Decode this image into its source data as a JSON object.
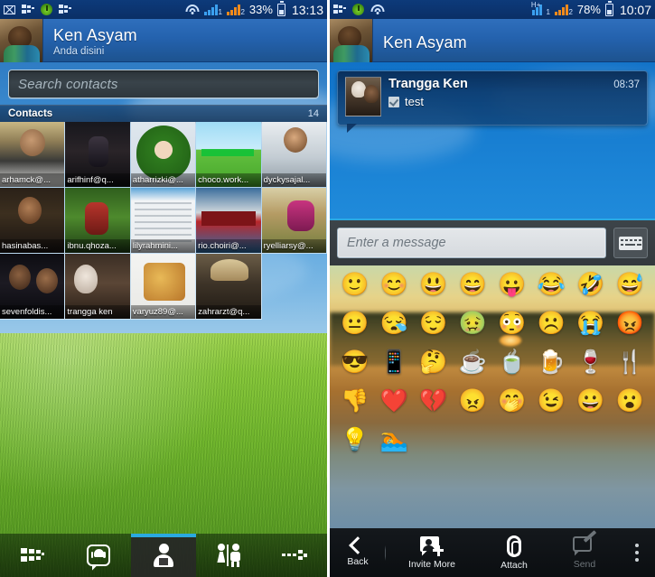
{
  "left": {
    "statusbar": {
      "icons": [
        "mail-icon",
        "bbm-icon",
        "power-icon",
        "bbm-icon-2"
      ],
      "wifi_icon": "wifi-icon",
      "signal1_label": "1",
      "signal2_label": "2",
      "battery_percent": "33%",
      "battery_icon": "battery-icon",
      "time": "13:13"
    },
    "header": {
      "name": "Ken Asyam",
      "subtitle": "Anda disini",
      "avatar": "user-avatar"
    },
    "search": {
      "placeholder": "Search contacts",
      "value": ""
    },
    "section": {
      "title": "Contacts",
      "count": "14"
    },
    "contacts": [
      {
        "name": "arhamck@...",
        "photo": "p1"
      },
      {
        "name": "arifhinf@q...",
        "photo": "p2"
      },
      {
        "name": "atharrizki@...",
        "photo": "p3"
      },
      {
        "name": "choco.work...",
        "photo": "p4"
      },
      {
        "name": "dyckysajal...",
        "photo": "p5"
      },
      {
        "name": "hasinabas...",
        "photo": "p6"
      },
      {
        "name": "ibnu.qhoza...",
        "photo": "p7"
      },
      {
        "name": "lilyrahmini...",
        "photo": "p8"
      },
      {
        "name": "rio.choiri@...",
        "photo": "p9"
      },
      {
        "name": "ryelliarsy@...",
        "photo": "p10"
      },
      {
        "name": "sevenfoldis...",
        "photo": "p11"
      },
      {
        "name": "trangga ken",
        "photo": "p12"
      },
      {
        "name": "varyuz89@...",
        "photo": "p13"
      },
      {
        "name": "zahrarzt@q...",
        "photo": "p14"
      }
    ],
    "nav": [
      {
        "name": "updates",
        "icon": "bbm-list-icon",
        "active": false
      },
      {
        "name": "chats",
        "icon": "chat-bubble-icon",
        "active": false
      },
      {
        "name": "contacts",
        "icon": "person-icon",
        "active": true
      },
      {
        "name": "groups",
        "icon": "groups-icon",
        "active": false
      },
      {
        "name": "more",
        "icon": "bbm-arrow-icon",
        "active": false
      }
    ]
  },
  "right": {
    "statusbar": {
      "icons": [
        "bbm-icon",
        "power-icon",
        "wifi-icon"
      ],
      "network_type": "H+",
      "signal1_label": "1",
      "signal2_label": "2",
      "battery_percent": "78%",
      "battery_icon": "battery-icon",
      "time": "10:07"
    },
    "header": {
      "name": "Ken Asyam",
      "avatar": "user-avatar"
    },
    "message": {
      "sender": "Trangga Ken",
      "time": "08:37",
      "text": "test",
      "status_icon": "read-check-icon",
      "avatar": "sender-avatar"
    },
    "input": {
      "placeholder": "Enter a message",
      "value": "",
      "keyboard_icon": "keyboard-icon"
    },
    "emoji_pager": {
      "page_indicator": "page-dot"
    },
    "emoji_rows": [
      [
        {
          "name": "smile",
          "glyph": "🙂"
        },
        {
          "name": "happy",
          "glyph": "😊"
        },
        {
          "name": "big-grin",
          "glyph": "😃"
        },
        {
          "name": "laugh",
          "glyph": "😄"
        },
        {
          "name": "tongue-out",
          "glyph": "😛"
        },
        {
          "name": "laughing-tears",
          "glyph": "😂"
        },
        {
          "name": "rofl",
          "glyph": "🤣"
        },
        {
          "name": "grin-sweat",
          "glyph": "😅"
        }
      ],
      [
        {
          "name": "neutral",
          "glyph": "😐"
        },
        {
          "name": "sleepy",
          "glyph": "😪"
        },
        {
          "name": "shy-smile",
          "glyph": "😌"
        },
        {
          "name": "sick-green",
          "glyph": "🤢"
        },
        {
          "name": "blushing",
          "glyph": "😳"
        },
        {
          "name": "sad-frown",
          "glyph": "☹️"
        },
        {
          "name": "crying",
          "glyph": "😭"
        },
        {
          "name": "angry-red",
          "glyph": "😡"
        }
      ],
      [
        {
          "name": "sunglasses",
          "glyph": "😎"
        },
        {
          "name": "phone-call",
          "glyph": "📱"
        },
        {
          "name": "thinking",
          "glyph": "🤔"
        },
        {
          "name": "drinking",
          "glyph": "☕"
        },
        {
          "name": "coffee-cup",
          "glyph": "🍵"
        },
        {
          "name": "beer-mug",
          "glyph": "🍺"
        },
        {
          "name": "wine-glass",
          "glyph": "🍷"
        },
        {
          "name": "fork-knife",
          "glyph": "🍴"
        }
      ],
      [
        {
          "name": "thumbs-down",
          "glyph": "👎"
        },
        {
          "name": "heart",
          "glyph": "❤️"
        },
        {
          "name": "broken-heart",
          "glyph": "💔"
        },
        {
          "name": "angry-punch",
          "glyph": "😠"
        },
        {
          "name": "cool-laugh",
          "glyph": "🤭"
        },
        {
          "name": "wink-blush",
          "glyph": "😉"
        },
        {
          "name": "big-smile",
          "glyph": "😀"
        },
        {
          "name": "surprised",
          "glyph": "😮"
        }
      ],
      [
        {
          "name": "lightbulb",
          "glyph": "💡"
        },
        {
          "name": "diving",
          "glyph": "🏊"
        }
      ]
    ],
    "actions": {
      "back": {
        "label": "Back",
        "icon": "chevron-left-icon",
        "enabled": true
      },
      "invite": {
        "label": "Invite More",
        "icon": "invite-person-icon",
        "enabled": true
      },
      "attach": {
        "label": "Attach",
        "icon": "paperclip-icon",
        "enabled": true
      },
      "send": {
        "label": "Send",
        "icon": "send-compose-icon",
        "enabled": false
      },
      "overflow": {
        "icon": "overflow-menu-icon"
      }
    }
  },
  "colors": {
    "header_blue": "#2462ae",
    "status_blue": "#0d3a7a",
    "accent_cyan": "#2aaae4",
    "grass_green": "#6fb42c",
    "chat_sky": "#2c9ae4"
  }
}
